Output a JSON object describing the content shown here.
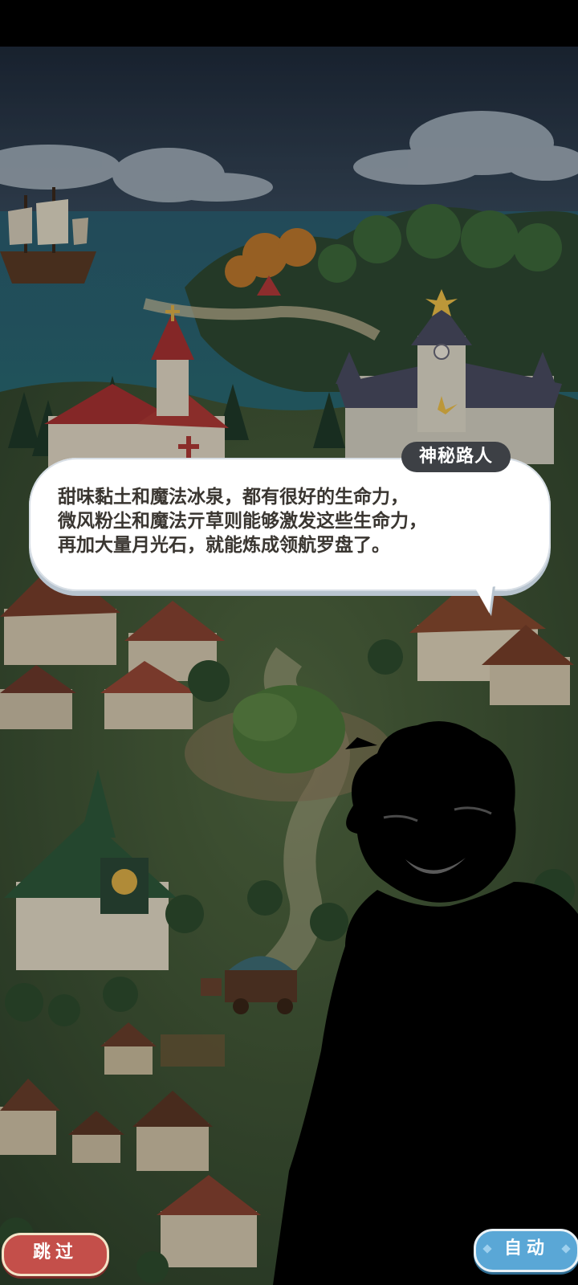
{
  "dialog": {
    "speaker": "神秘路人",
    "lines": [
      "甜味黏土和魔法冰泉，都有很好的生命力，",
      "微风粉尘和魔法亓草则能够激发这些生命力，",
      "再加大量月光石，就能炼成领航罗盘了。"
    ]
  },
  "controls": {
    "skip_label": "跳过",
    "auto_label": "自动"
  },
  "colors": {
    "sky": "#2a3a4e",
    "sea": "#27586b",
    "grass": "#3f5a36",
    "bubble": "#ffffff",
    "speaker_tag": "#3d4045",
    "skip_button": "#c44f4a",
    "auto_button": "#5aa7d6"
  },
  "icons": {
    "speaker_silhouette": "mysterious-person-silhouette"
  }
}
